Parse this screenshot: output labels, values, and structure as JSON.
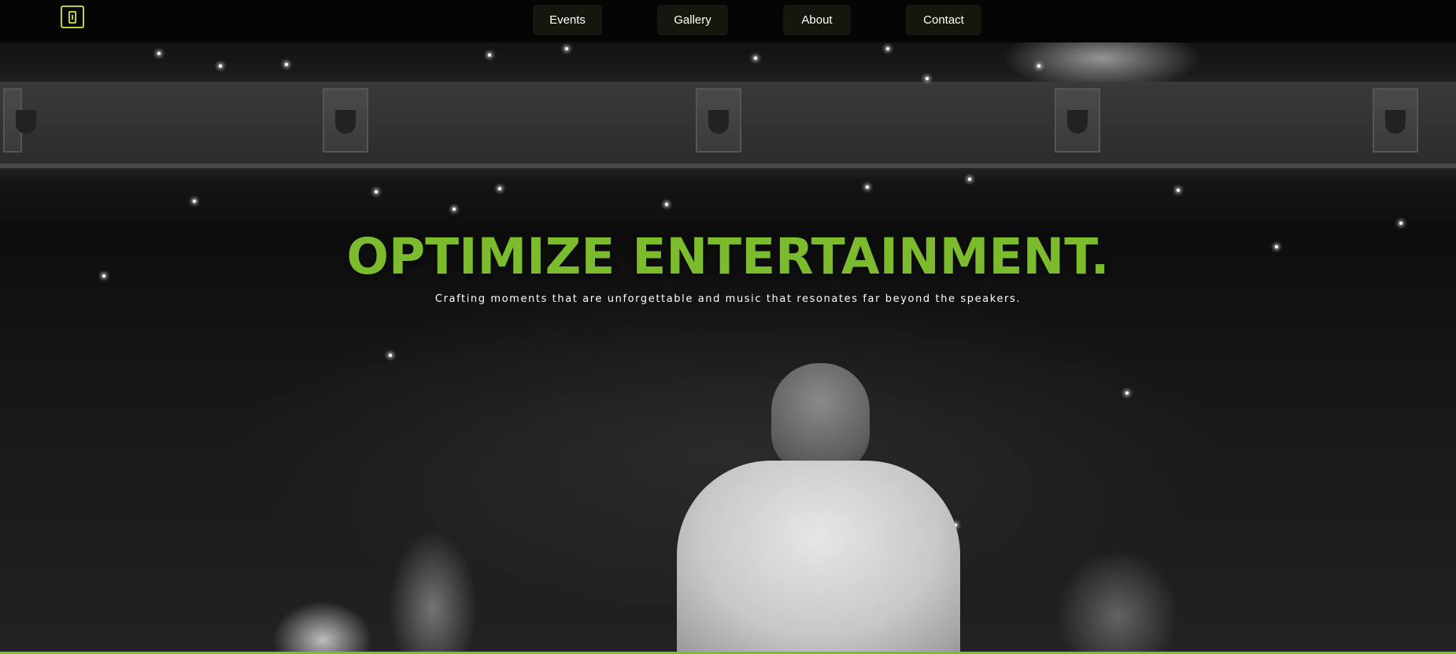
{
  "nav": {
    "logo_icon": "phone-logo-icon",
    "items": [
      {
        "label": "Events"
      },
      {
        "label": "Gallery"
      },
      {
        "label": "About"
      },
      {
        "label": "Contact"
      }
    ]
  },
  "hero": {
    "title": "OPTIMIZE ENTERTAINMENT.",
    "subtitle": "Crafting moments that are unforgettable and music that resonates far beyond the speakers.",
    "background_image": "concert-crowd-photo"
  },
  "colors": {
    "accent": "#7dbb2e",
    "logo": "#b6d33a",
    "nav_bg": "#050505",
    "nav_button_bg": "#16160f"
  }
}
